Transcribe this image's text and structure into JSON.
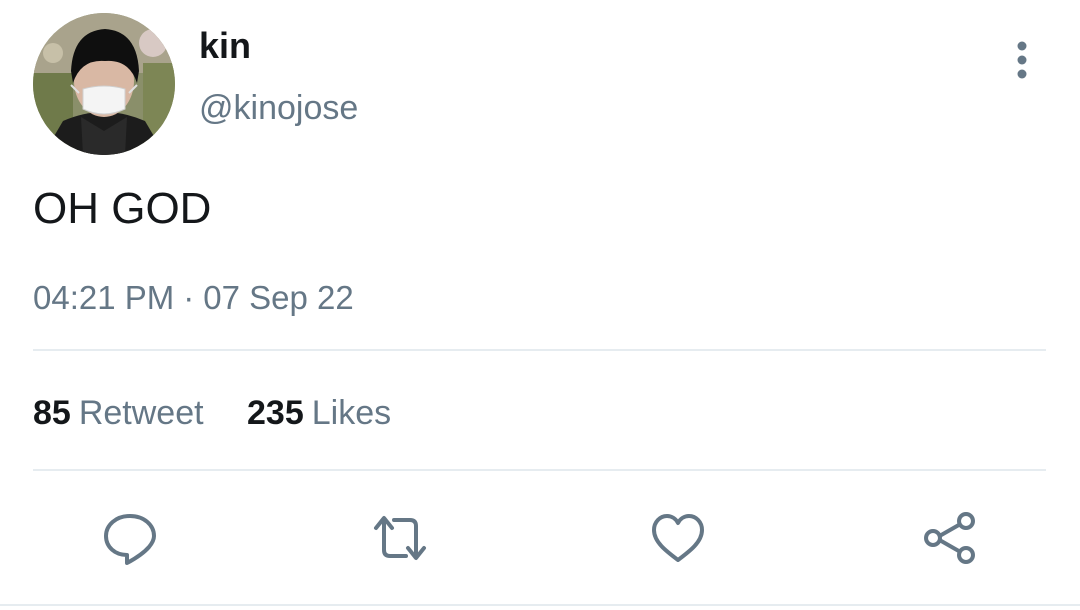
{
  "author": {
    "display_name": "kin",
    "handle": "@kinojose",
    "avatar_icon": "profile-photo"
  },
  "tweet": {
    "text": "OH GOD",
    "time": "04:21 PM",
    "separator": "·",
    "date": "07 Sep 22"
  },
  "stats": {
    "retweet_count": "85",
    "retweet_label": "Retweet",
    "likes_count": "235",
    "likes_label": "Likes"
  },
  "actions": {
    "reply_icon": "speech-bubble-icon",
    "retweet_icon": "retweet-arrows-icon",
    "like_icon": "heart-icon",
    "share_icon": "share-nodes-icon",
    "more_icon": "vertical-ellipsis-icon"
  },
  "colors": {
    "primary_text": "#14171a",
    "secondary_text": "#657786",
    "divider": "#e6ecf0",
    "background": "#ffffff"
  }
}
